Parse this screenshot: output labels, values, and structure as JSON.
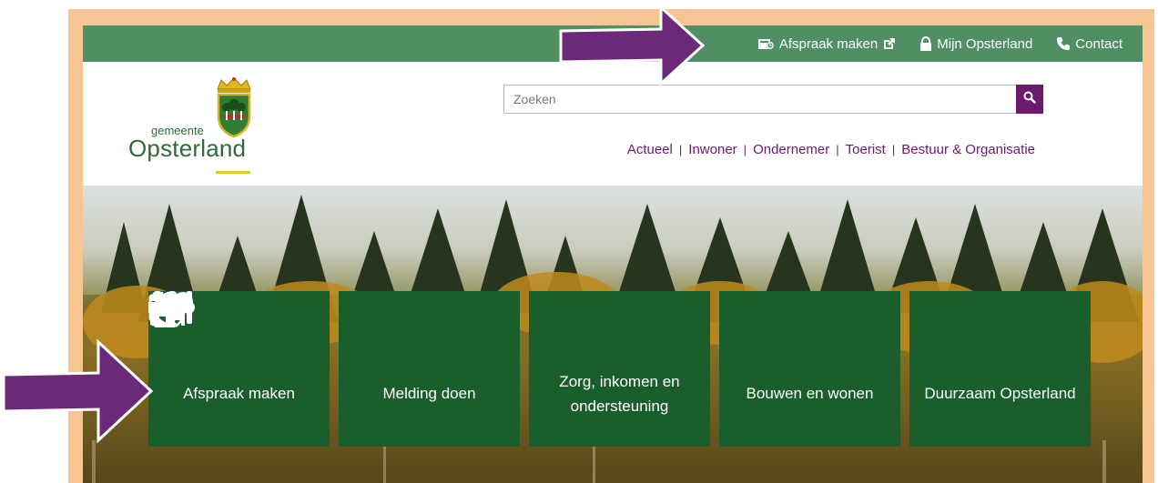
{
  "topbar": {
    "links": [
      {
        "label": "Afspraak maken",
        "icon": "calendar-camera-icon",
        "trailing_icon": "external-link-icon"
      },
      {
        "label": "Mijn Opsterland",
        "icon": "lock-icon"
      },
      {
        "label": "Contact",
        "icon": "phone-icon"
      }
    ]
  },
  "logo": {
    "small_text": "gemeente",
    "big_text": "Opsterland",
    "icon": "municipality-crest-icon"
  },
  "search": {
    "placeholder": "Zoeken",
    "value": "",
    "icon": "search-icon"
  },
  "nav": {
    "items": [
      "Actueel",
      "Inwoner",
      "Ondernemer",
      "Toerist",
      "Bestuur & Organisatie"
    ],
    "separator": "|"
  },
  "tiles": [
    {
      "label": "Afspraak maken",
      "icon": "calendar-icon"
    },
    {
      "label": "Melding doen",
      "icon": "megaphone-icon"
    },
    {
      "label": "Zorg, inkomen en ondersteuning",
      "icon": "people-care-icon"
    },
    {
      "label": "Bouwen en wonen",
      "icon": "house-tree-icon"
    },
    {
      "label": "Duurzaam Opsterland",
      "icon": "sustainability-hand-icon"
    }
  ],
  "annotations": {
    "arrow_color": "#6b2a78",
    "arrows": [
      "arrow-to-topbar-afspraak",
      "arrow-to-tile-afspraak"
    ]
  },
  "colors": {
    "frame": "#f6c592",
    "topbar": "#4f8f63",
    "tile": "#1a5e2c",
    "accent": "#6b1a6e",
    "logo_green": "#2f6b3b"
  }
}
